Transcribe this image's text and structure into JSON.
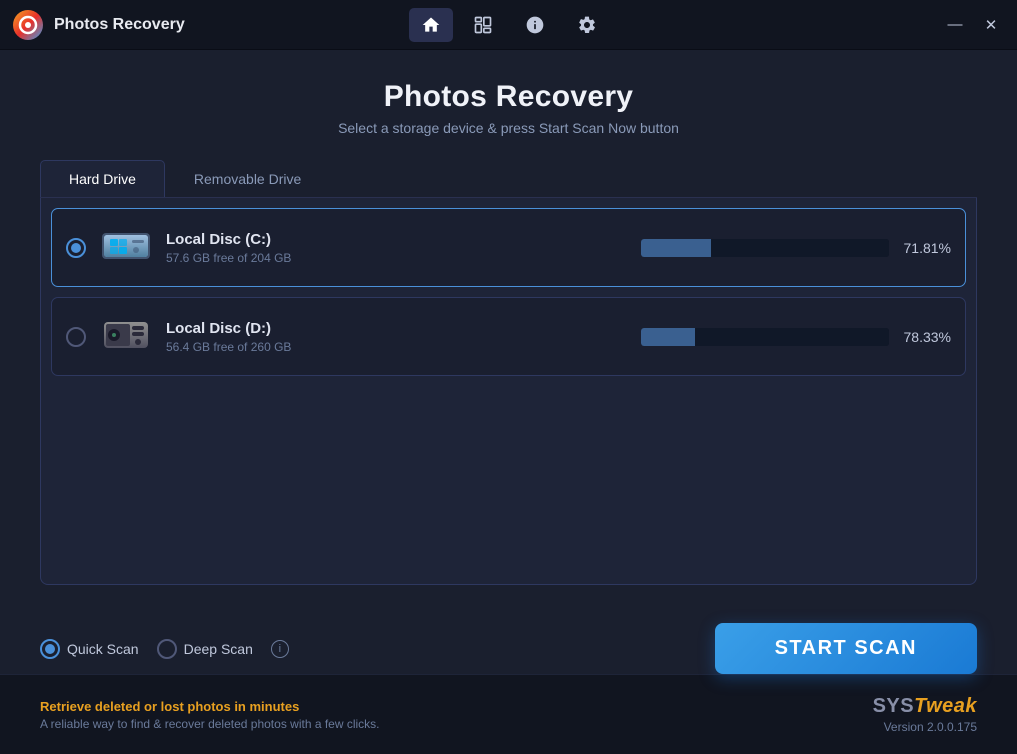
{
  "app": {
    "title": "Photos Recovery",
    "logo_alt": "Photos Recovery Logo"
  },
  "titlebar": {
    "nav": {
      "home_label": "🏠",
      "search_label": "🔍",
      "info_label": "ℹ",
      "settings_label": "⚙"
    },
    "controls": {
      "minimize": "—",
      "close": "✕"
    }
  },
  "page": {
    "title": "Photos Recovery",
    "subtitle": "Select a storage device & press Start Scan Now button"
  },
  "tabs": [
    {
      "id": "hard-drive",
      "label": "Hard Drive",
      "active": true
    },
    {
      "id": "removable-drive",
      "label": "Removable Drive",
      "active": false
    }
  ],
  "drives": [
    {
      "id": "c",
      "name": "Local Disc (C:)",
      "space": "57.6 GB free of 204 GB",
      "percent": "71.81%",
      "used_pct": 71.81,
      "free_pct": 28.19,
      "selected": true
    },
    {
      "id": "d",
      "name": "Local Disc (D:)",
      "space": "56.4 GB free of 260 GB",
      "percent": "78.33%",
      "used_pct": 78.33,
      "free_pct": 21.67,
      "selected": false
    }
  ],
  "scan_options": {
    "quick_scan": {
      "label": "Quick Scan",
      "selected": true
    },
    "deep_scan": {
      "label": "Deep Scan",
      "selected": false
    }
  },
  "start_button": {
    "label": "START SCAN"
  },
  "footer": {
    "promo": "Retrieve deleted or lost photos in minutes",
    "desc": "A reliable way to find & recover deleted photos with a few clicks.",
    "brand_sys": "SYS",
    "brand_tweak": "Tweak",
    "version": "Version 2.0.0.175"
  }
}
